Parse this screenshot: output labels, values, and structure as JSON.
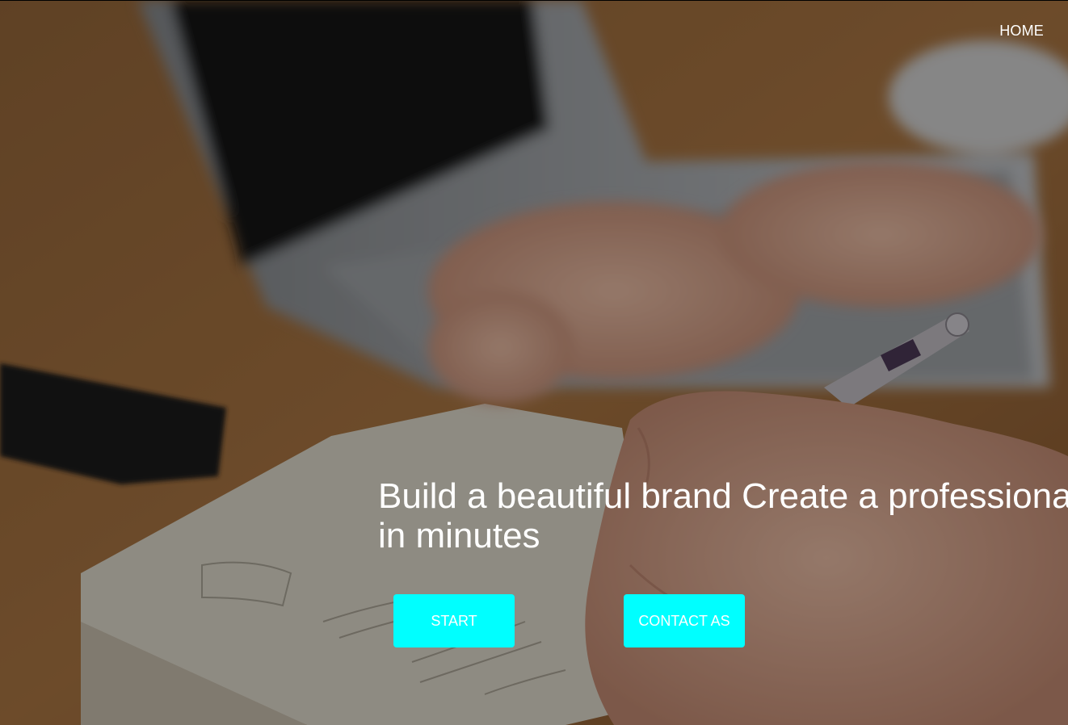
{
  "nav": {
    "home_label": "HOME"
  },
  "hero": {
    "headline": "Build a beautiful brand Create a professional brand in minutes",
    "background_image": "blurred photo of a hand writing in a notebook with a pen in front of a laptop on a wooden desk"
  },
  "buttons": {
    "start_label": "START",
    "contact_label": "CONTACT AS"
  },
  "colors": {
    "button_bg": "#00ffff",
    "button_text": "#ffffff",
    "text": "#ffffff"
  }
}
